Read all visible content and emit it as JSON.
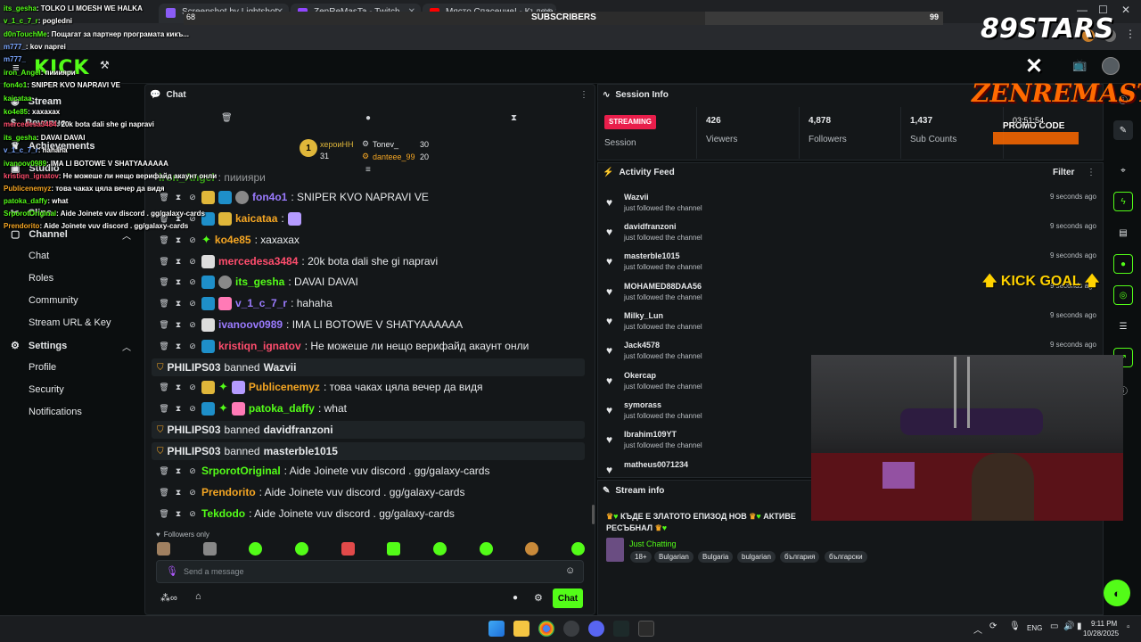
{
  "browser": {
    "tabs": [
      {
        "label": "Screenshot by Lightshot"
      },
      {
        "label": "ZenReMasTa - Twitch"
      },
      {
        "label": "Място Спасение! - Къде е З..."
      }
    ]
  },
  "overlay": {
    "subscriber_bar": {
      "left_value": "68",
      "label": "SUBSCRIBERS",
      "right_value": "99",
      "progress": 0.687
    },
    "chat_overlay": [
      {
        "user": "its_gesha",
        "text": ": TOLKO LI MOESH WE HALKA",
        "color": "#53fc18"
      },
      {
        "user": "v_1_c_7_r",
        "text": ": pogledni",
        "color": "#53fc18"
      },
      {
        "user": "d0nTouchMe",
        "text": ": Пощагат за партнер програмата кикъ...",
        "color": "#53fc18"
      },
      {
        "user": "m777_",
        "text": ": kov naprei",
        "color": "#7ba6ff"
      },
      {
        "user": "m777_",
        "text": "",
        "color": "#7ba6ff"
      },
      {
        "user": "iron_Angel",
        "text": ": пииияри",
        "color": "#53fc18"
      },
      {
        "user": "fon4o1",
        "text": ": SNIPER KVO NAPRAVI VE",
        "color": "#53fc18"
      },
      {
        "user": "kaicataa",
        "text": "",
        "color": "#53fc18"
      },
      {
        "user": "mercedesa3484",
        "text": ": 20k bota dali she gi napravi",
        "color": "#ff4d6d"
      },
      {
        "user": "ko4e85",
        "text": ": xaxaxax",
        "color": "#53fc18"
      },
      {
        "user": "its_gesha",
        "text": ": DAVAI DAVAI",
        "color": "#53fc18"
      },
      {
        "user": "v_1_c_7_r",
        "text": ": hahaha",
        "color": "#7ba6ff"
      },
      {
        "user": "ivanoov0989",
        "text": ": IMA LI BOTOWE V SHATYAAAAAA",
        "color": "#53fc18"
      },
      {
        "user": "kristiqn_ignatov",
        "text": ": Не можеше ли нещо верифайд акаунт онли",
        "color": "#ff4d6d"
      },
      {
        "user": "Publicenemyz",
        "text": ": това чаках цяла вечер да видя",
        "color": "#f5a623"
      },
      {
        "user": "patoka_daffy",
        "text": ": what",
        "color": "#53fc18"
      },
      {
        "user": "SrporotOriginal",
        "text": ": Aide Joinete vuv discord . gg/galaxy-cards",
        "color": "#53fc18"
      },
      {
        "user": "Prendorito",
        "text": ": Aide Joinete vuv discord . gg/galaxy-cards",
        "color": "#f5a623"
      }
    ],
    "logo_89stars": "89STARS",
    "zenremasta_logo": "ZENREMASTA",
    "promo_label": "PROMO CODE",
    "promo_time": "03:51:54",
    "kick_goal": "KICK GOAL"
  },
  "sidebar": {
    "items": [
      {
        "label": "Stream"
      },
      {
        "label": "Revenue"
      },
      {
        "label": "Achievements"
      },
      {
        "label": "Studio"
      },
      {
        "label": "Clips"
      }
    ],
    "channel_section": "Channel",
    "channel_items": [
      "Chat",
      "Roles",
      "Community",
      "Stream URL & Key"
    ],
    "settings_section": "Settings",
    "settings_items": [
      "Profile",
      "Security",
      "Notifications"
    ]
  },
  "chat": {
    "title": "Chat",
    "top_gifters": [
      {
        "rank": "1",
        "name": "хероиHH",
        "count": "31"
      },
      {
        "name": "Tonev_",
        "count": "30"
      },
      {
        "name": "danteee_99",
        "count": "20"
      }
    ],
    "partial_line": {
      "user": "iron_Angel",
      "text": ": пииияри"
    },
    "messages": [
      {
        "user": "fon4o1",
        "text": ": SNIPER KVO NAPRAVI VE",
        "color": "#9b7bff"
      },
      {
        "user": "kaicataa",
        "text": ":",
        "color": "#f5a623"
      },
      {
        "user": "ko4e85",
        "text": ": хахахах",
        "color": "#f5a623"
      },
      {
        "user": "mercedesa3484",
        "text": ": 20k bota dali she gi napravi",
        "color": "#ff4d6d"
      },
      {
        "user": "its_gesha",
        "text": ": DAVAI DAVAI",
        "color": "#53fc18"
      },
      {
        "user": "v_1_c_7_r",
        "text": ": hahaha",
        "color": "#9b7bff"
      },
      {
        "user": "ivanoov0989",
        "text": ": IMA LI BOTOWE V SHATYAAAAAA",
        "color": "#9b7bff"
      },
      {
        "user": "kristiqn_ignatov",
        "text": ": Не можеше ли нещо верифайд акаунт онли",
        "color": "#ff4d6d"
      }
    ],
    "ban1": {
      "mod": "PHILIPS03",
      "action": "banned",
      "target": "Wazvii"
    },
    "messages2": [
      {
        "user": "Publicenemyz",
        "text": ": това чакax цяла вечер да видя",
        "color": "#f5a623"
      },
      {
        "user": "patoka_daffy",
        "text": ": what",
        "color": "#53fc18"
      }
    ],
    "ban2": {
      "mod": "PHILIPS03",
      "action": "banned",
      "target": "davidfranzoni"
    },
    "ban3": {
      "mod": "PHILIPS03",
      "action": "banned",
      "target": "masterble1015"
    },
    "messages3": [
      {
        "user": "SrporotOriginal",
        "text": ": Aide Joinete vuv discord . gg/galaxy-cards",
        "color": "#53fc18"
      },
      {
        "user": "Prendorito",
        "text": ": Aide Joinete vuv discord . gg/galaxy-cards",
        "color": "#f5a623"
      },
      {
        "user": "Tekdodo",
        "text": ": Aide Joinete vuv discord . gg/galaxy-cards",
        "color": "#53fc18"
      }
    ],
    "followers_only": "Followers only",
    "input_placeholder": "Send a message",
    "send_label": "Chat"
  },
  "session": {
    "title": "Session Info",
    "status_badge": "STREAMING",
    "session_label": "Session",
    "stats": [
      {
        "value": "426",
        "label": "Viewers"
      },
      {
        "value": "4,878",
        "label": "Followers"
      },
      {
        "value": "1,437",
        "label": "Sub Counts"
      }
    ]
  },
  "activity": {
    "title": "Activity Feed",
    "filter_label": "Filter",
    "items": [
      {
        "name": "Wazvii",
        "desc": "just followed the channel",
        "time": "9 seconds ago"
      },
      {
        "name": "davidfranzoni",
        "desc": "just followed the channel",
        "time": "9 seconds ago"
      },
      {
        "name": "masterble1015",
        "desc": "just followed the channel",
        "time": "9 seconds ago"
      },
      {
        "name": "MOHAMED88DAA56",
        "desc": "just followed the channel",
        "time": "9 seconds ago"
      },
      {
        "name": "Milky_Lun",
        "desc": "just followed the channel",
        "time": "9 seconds ago"
      },
      {
        "name": "Jack4578",
        "desc": "just followed the channel",
        "time": "9 seconds ago"
      },
      {
        "name": "Okercap",
        "desc": "just followed the channel",
        "time": ""
      },
      {
        "name": "symorass",
        "desc": "just followed the channel",
        "time": ""
      },
      {
        "name": "Ibrahim109YT",
        "desc": "just followed the channel",
        "time": ""
      },
      {
        "name": "matheus0071234",
        "desc": "",
        "time": ""
      }
    ]
  },
  "stream_info": {
    "title": "Stream info",
    "stream_title_line1": "КЪДЕ Е ЗЛАТОТО ЕПИЗОД НОВ",
    "stream_title_extra": "АКТИВЕ",
    "stream_title_line2": "РЕСЪБНАЛ",
    "category": "Just Chatting",
    "tags": [
      "18+",
      "Bulgarian",
      "Bulgaria",
      "bulgarian",
      "българия",
      "български"
    ]
  },
  "taskbar": {
    "lang": "ENG",
    "time": "9:11 PM",
    "date": "10/28/2025"
  },
  "colors": {
    "accent": "#53fc18",
    "streaming": "#e91e4b",
    "panel": "#141719",
    "bg": "#0b0e0f"
  }
}
